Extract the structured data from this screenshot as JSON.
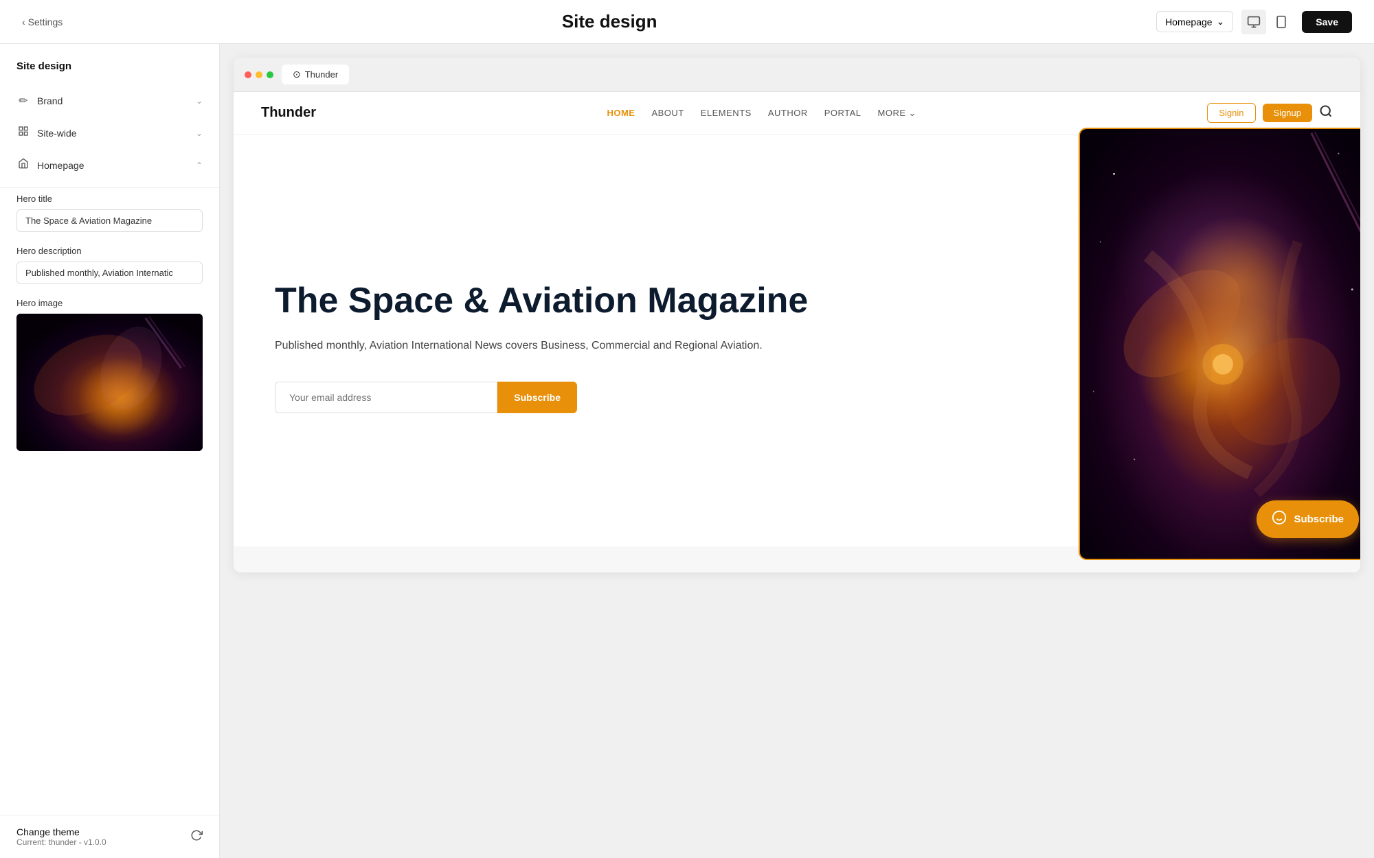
{
  "topBar": {
    "back_label": "Settings",
    "title": "Site design",
    "dropdown_label": "Homepage",
    "save_label": "Save"
  },
  "sidebar": {
    "section_title": "Site design",
    "nav_items": [
      {
        "id": "brand",
        "icon": "✏️",
        "label": "Brand",
        "has_chevron": true
      },
      {
        "id": "site-wide",
        "icon": "⊞",
        "label": "Site-wide",
        "has_chevron": true
      },
      {
        "id": "homepage",
        "icon": "⌂",
        "label": "Homepage",
        "has_chevron": true,
        "expanded": true
      }
    ],
    "hero_title_label": "Hero title",
    "hero_title_value": "The Space & Aviation Magazine",
    "hero_desc_label": "Hero description",
    "hero_desc_value": "Published monthly, Aviation Internatic",
    "hero_image_label": "Hero image",
    "change_theme_label": "Change theme",
    "current_theme": "Current: thunder - v1.0.0"
  },
  "sitePreview": {
    "browser_tab_label": "Thunder",
    "nav": {
      "logo": "Thunder",
      "items": [
        "HOME",
        "ABOUT",
        "ELEMENTS",
        "AUTHOR",
        "PORTAL",
        "MORE"
      ],
      "signin_label": "Signin",
      "signup_label": "Signup"
    },
    "hero": {
      "title": "The Space & Aviation Magazine",
      "description": "Published monthly, Aviation International News covers Business, Commercial and Regional Aviation.",
      "email_placeholder": "Your email address",
      "subscribe_label": "Subscribe",
      "floating_subscribe_label": "Subscribe"
    }
  }
}
